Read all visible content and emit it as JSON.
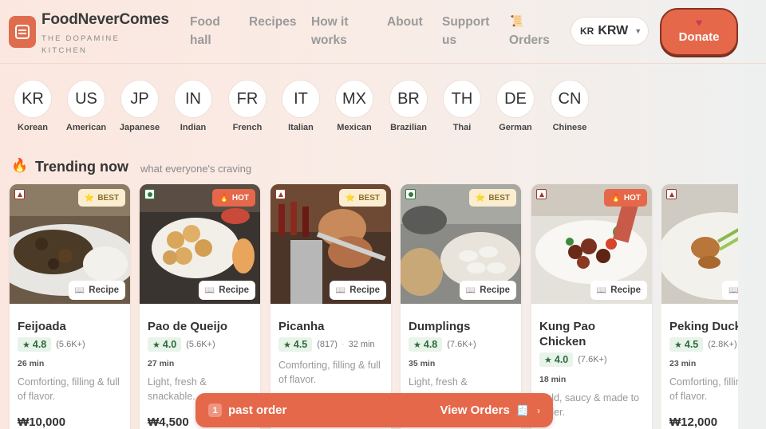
{
  "brand": {
    "name": "FoodNeverComes",
    "tagline": "THE DOPAMINE KITCHEN"
  },
  "nav": [
    {
      "label": "Food hall"
    },
    {
      "label": "Recipes"
    },
    {
      "label": "How it works"
    },
    {
      "label": "About"
    },
    {
      "label": "Support us"
    },
    {
      "label": "Orders",
      "icon": "scroll-icon"
    }
  ],
  "currency": {
    "flag": "KR",
    "code": "KRW"
  },
  "donate": {
    "label": "Donate"
  },
  "countries": [
    {
      "code": "KR",
      "name": "Korean"
    },
    {
      "code": "US",
      "name": "American"
    },
    {
      "code": "JP",
      "name": "Japanese"
    },
    {
      "code": "IN",
      "name": "Indian"
    },
    {
      "code": "FR",
      "name": "French"
    },
    {
      "code": "IT",
      "name": "Italian"
    },
    {
      "code": "MX",
      "name": "Mexican"
    },
    {
      "code": "BR",
      "name": "Brazilian"
    },
    {
      "code": "TH",
      "name": "Thai"
    },
    {
      "code": "DE",
      "name": "German"
    },
    {
      "code": "CN",
      "name": "Chinese"
    }
  ],
  "trending": {
    "title": "Trending now",
    "subtitle": "what everyone's craving"
  },
  "recipe_label": "Recipe",
  "dishes": [
    {
      "name": "Feijoada",
      "diet": "nonveg",
      "badge": "BEST",
      "rating": "4.8",
      "reviews": "(5.6K+)",
      "time": "26 min",
      "desc": "Comforting, filling & full of flavor.",
      "price": "₩10,000"
    },
    {
      "name": "Pao de Queijo",
      "diet": "veg",
      "badge": "HOT",
      "rating": "4.0",
      "reviews": "(5.6K+)",
      "time": "27 min",
      "desc": "Light, fresh & snackable.",
      "price": "₩4,500"
    },
    {
      "name": "Picanha",
      "diet": "nonveg",
      "badge": "BEST",
      "rating": "4.5",
      "reviews": "(817)",
      "time": "32 min",
      "desc": "Comforting, filling & full of flavor.",
      "price": ""
    },
    {
      "name": "Dumplings",
      "diet": "veg",
      "badge": "BEST",
      "rating": "4.8",
      "reviews": "(7.6K+)",
      "time": "35 min",
      "desc": "Light, fresh &",
      "price": ""
    },
    {
      "name": "Kung Pao Chicken",
      "diet": "nonveg",
      "badge": "HOT",
      "rating": "4.0",
      "reviews": "(7.6K+)",
      "time": "18 min",
      "desc": "Bold, saucy & made to order.",
      "price": ""
    },
    {
      "name": "Peking Duck",
      "diet": "nonveg",
      "badge": "",
      "rating": "4.5",
      "reviews": "(2.8K+)",
      "time": "23 min",
      "desc": "Comforting, filling & full of flavor.",
      "price": "₩12,000"
    }
  ],
  "orders_bar": {
    "count": "1",
    "label": "past order",
    "action": "View Orders"
  },
  "colors": {
    "accent": "#e5684a",
    "best_badge": "#fbedd0",
    "rating_bg": "#e8f3ea"
  }
}
